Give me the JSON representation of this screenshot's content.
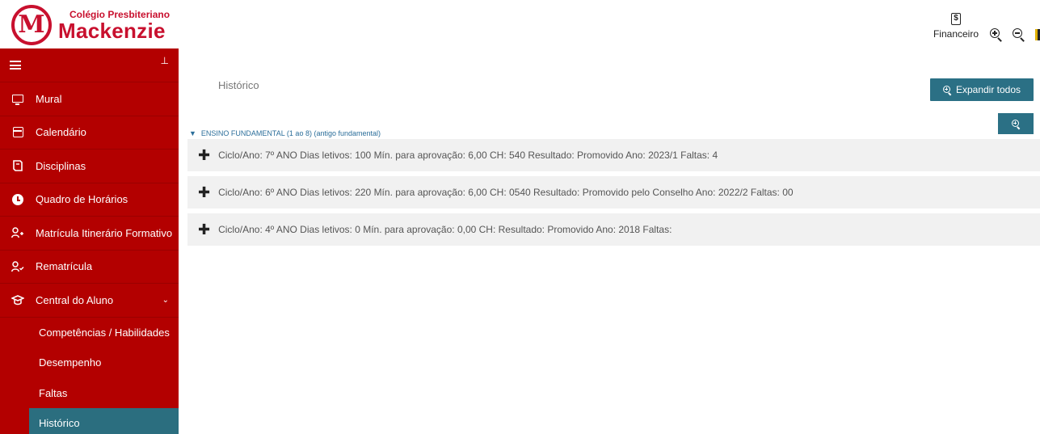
{
  "header": {
    "logo_letter": "M",
    "logo_small": "Colégio Presbiteriano",
    "logo_big": "Mackenzie",
    "financeiro_label": "Financeiro",
    "financeiro_icon_glyph": "$"
  },
  "sidebar": {
    "items": [
      {
        "label": "Mural",
        "icon": "monitor-icon"
      },
      {
        "label": "Calendário",
        "icon": "calendar-icon"
      },
      {
        "label": "Disciplinas",
        "icon": "book-icon"
      },
      {
        "label": "Quadro de Horários",
        "icon": "clock-icon"
      },
      {
        "label": "Matrícula Itinerário Formativo",
        "icon": "user-plus-icon"
      },
      {
        "label": "Rematrícula",
        "icon": "user-check-icon"
      },
      {
        "label": "Central do Aluno",
        "icon": "graduation-cap-icon"
      }
    ],
    "sub_items": [
      {
        "label": "Competências / Habilidades"
      },
      {
        "label": "Desempenho"
      },
      {
        "label": "Faltas"
      },
      {
        "label": "Histórico"
      }
    ]
  },
  "main": {
    "title": "Histórico",
    "expand_all_label": "Expandir todos",
    "section_label": "ENSINO FUNDAMENTAL (1 ao 8) (antigo fundamental)",
    "rows": [
      {
        "text": "Ciclo/Ano: 7º ANO   Dias letivos: 100   Mín. para aprovação: 6,00   CH: 540   Resultado: Promovido   Ano: 2023/1   Faltas: 4"
      },
      {
        "text": "Ciclo/Ano: 6º ANO   Dias letivos: 220   Mín. para aprovação: 6,00   CH: 0540   Resultado: Promovido pelo Conselho   Ano: 2022/2   Faltas: 00"
      },
      {
        "text": "Ciclo/Ano: 4º ANO   Dias letivos: 0   Mín. para aprovação: 0,00   CH:   Resultado: Promovido   Ano: 2018   Faltas:"
      }
    ]
  },
  "colors": {
    "brand_red": "#b30000",
    "accent_teal": "#2b7085",
    "active_teal": "#2b6e7f",
    "link_blue": "#2b6e9a"
  }
}
